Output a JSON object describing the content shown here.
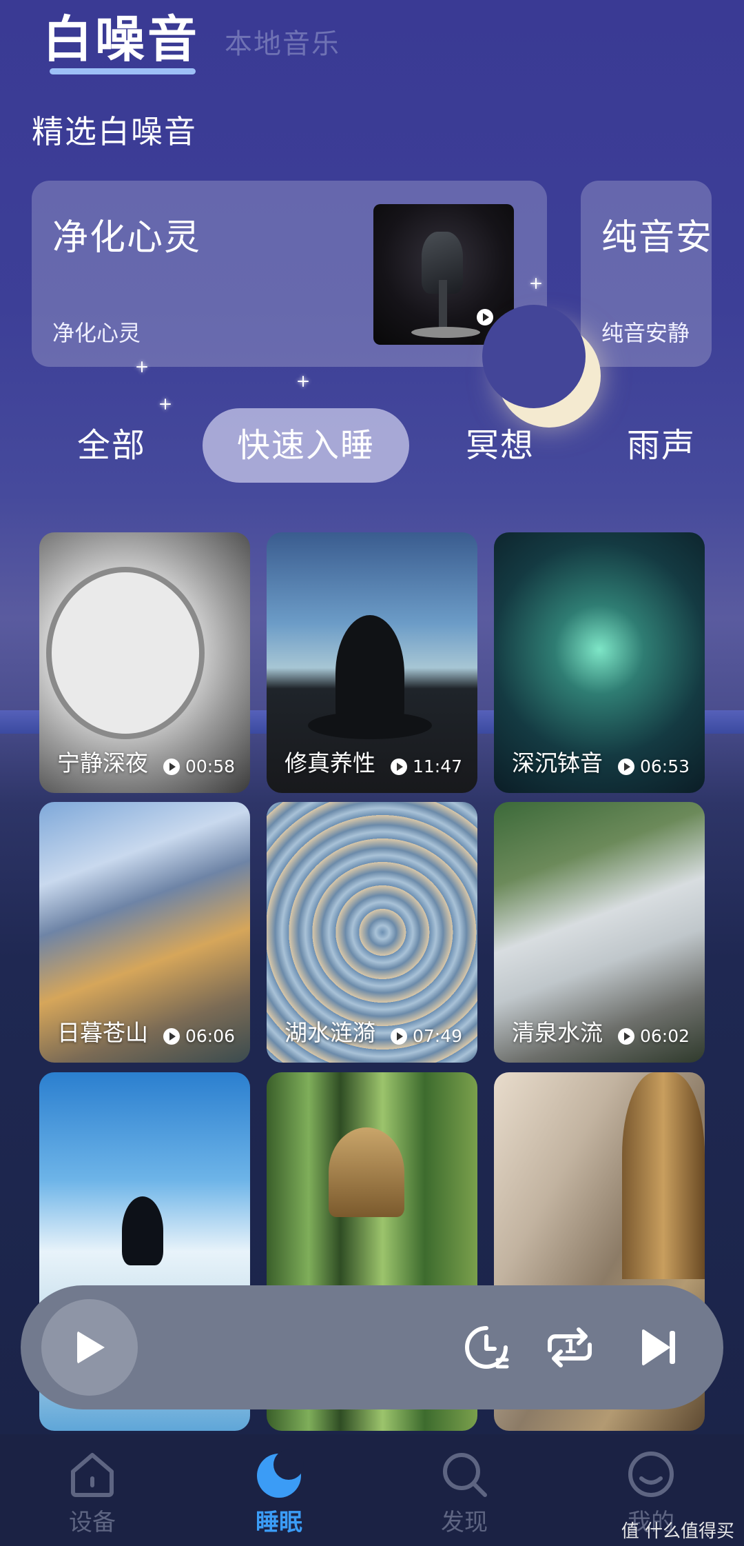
{
  "header": {
    "active_tab": "白噪音",
    "inactive_tab": "本地音乐"
  },
  "featured": {
    "section_title": "精选白噪音",
    "cards": [
      {
        "title": "净化心灵",
        "subtitle": "净化心灵"
      },
      {
        "title": "纯音安",
        "subtitle": "纯音安静"
      }
    ]
  },
  "categories": {
    "items": [
      "全部",
      "快速入睡",
      "冥想",
      "雨声"
    ],
    "active": "快速入睡"
  },
  "sounds": [
    {
      "title": "宁静深夜",
      "duration": "00:58"
    },
    {
      "title": "修真养性",
      "duration": "11:47"
    },
    {
      "title": "深沉钵音",
      "duration": "06:53"
    },
    {
      "title": "日暮苍山",
      "duration": "06:06"
    },
    {
      "title": "湖水涟漪",
      "duration": "07:49"
    },
    {
      "title": "清泉水流",
      "duration": "06:02"
    }
  ],
  "player": {
    "repeat_badge": "1",
    "icons": [
      "play-icon",
      "timer-icon",
      "repeat-one-icon",
      "skip-next-icon"
    ]
  },
  "bottom_nav": {
    "items": [
      {
        "label": "设备",
        "icon": "home-icon"
      },
      {
        "label": "睡眠",
        "icon": "moon-icon"
      },
      {
        "label": "发现",
        "icon": "search-icon"
      },
      {
        "label": "我的",
        "icon": "profile-icon"
      }
    ],
    "active": "睡眠"
  },
  "watermark": "值 什么值得买",
  "colors": {
    "accent_blue": "#3b9cf6",
    "nav_inactive": "#5e6582",
    "tab_underline": "#9dc0f7"
  }
}
